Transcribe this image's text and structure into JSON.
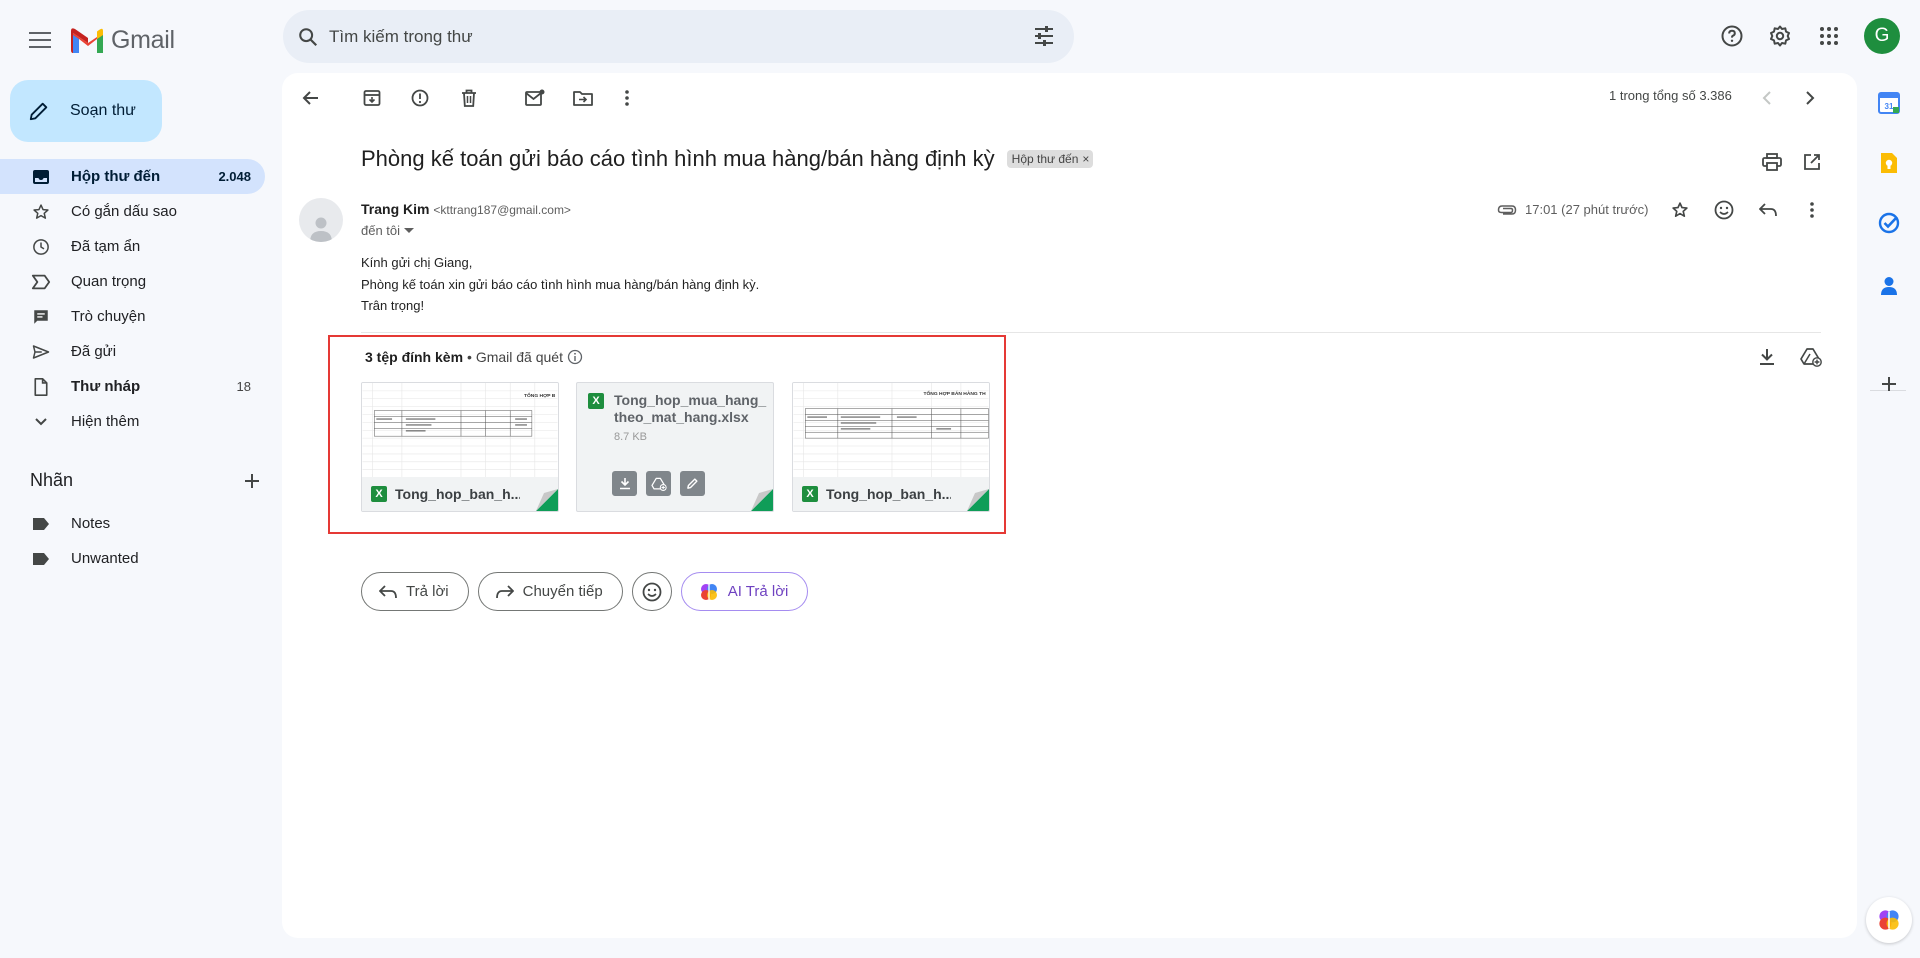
{
  "app": {
    "name": "Gmail"
  },
  "search": {
    "placeholder": "Tìm kiếm trong thư"
  },
  "account": {
    "initial": "G"
  },
  "compose": {
    "label": "Soạn thư"
  },
  "sidebar": {
    "items": [
      {
        "label": "Hộp thư đến",
        "count": "2.048",
        "icon": "inbox-icon"
      },
      {
        "label": "Có gắn dấu sao",
        "count": "",
        "icon": "star-icon"
      },
      {
        "label": "Đã tạm ẩn",
        "count": "",
        "icon": "clock-icon"
      },
      {
        "label": "Quan trọng",
        "count": "",
        "icon": "important-icon"
      },
      {
        "label": "Trò chuyện",
        "count": "",
        "icon": "chat-icon"
      },
      {
        "label": "Đã gửi",
        "count": "",
        "icon": "send-icon"
      },
      {
        "label": "Thư nháp",
        "count": "18",
        "icon": "draft-icon"
      },
      {
        "label": "Hiện thêm",
        "count": "",
        "icon": "chevron-down-icon"
      }
    ],
    "labels_title": "Nhãn",
    "labels": [
      {
        "label": "Notes"
      },
      {
        "label": "Unwanted"
      }
    ]
  },
  "toolbar": {
    "pager": "1 trong tổng số 3.386"
  },
  "email": {
    "subject": "Phòng kế toán gửi báo cáo tình hình mua hàng/bán hàng định kỳ",
    "label_chip": "Hộp thư đến",
    "sender_name": "Trang Kim",
    "sender_email": "<kttrang187@gmail.com>",
    "to": "đến tôi",
    "time": "17:01 (27 phút trước)",
    "body_lines": [
      "Kính gửi chị Giang,",
      "Phòng kế toán xin gửi báo cáo tình hình mua hàng/bán hàng định kỳ.",
      "Trân trọng!"
    ]
  },
  "attachments": {
    "title": "3 tệp đính kèm",
    "scanned": "• Gmail đã quét",
    "files": [
      {
        "name": "Tong_hop_ban_h...",
        "thumb_title": "TỔNG HỢP B"
      },
      {
        "name": "Tong_hop_mua_hang_theo_mat_hang.xlsx",
        "size": "8.7 KB"
      },
      {
        "name": "Tong_hop_ban_h...",
        "thumb_title": "TỔNG HỢP BÁN HÀNG TH"
      }
    ]
  },
  "actions": {
    "reply": "Trả lời",
    "forward": "Chuyển tiếp",
    "ai_reply": "AI Trả lời"
  },
  "calendar_day": "31"
}
